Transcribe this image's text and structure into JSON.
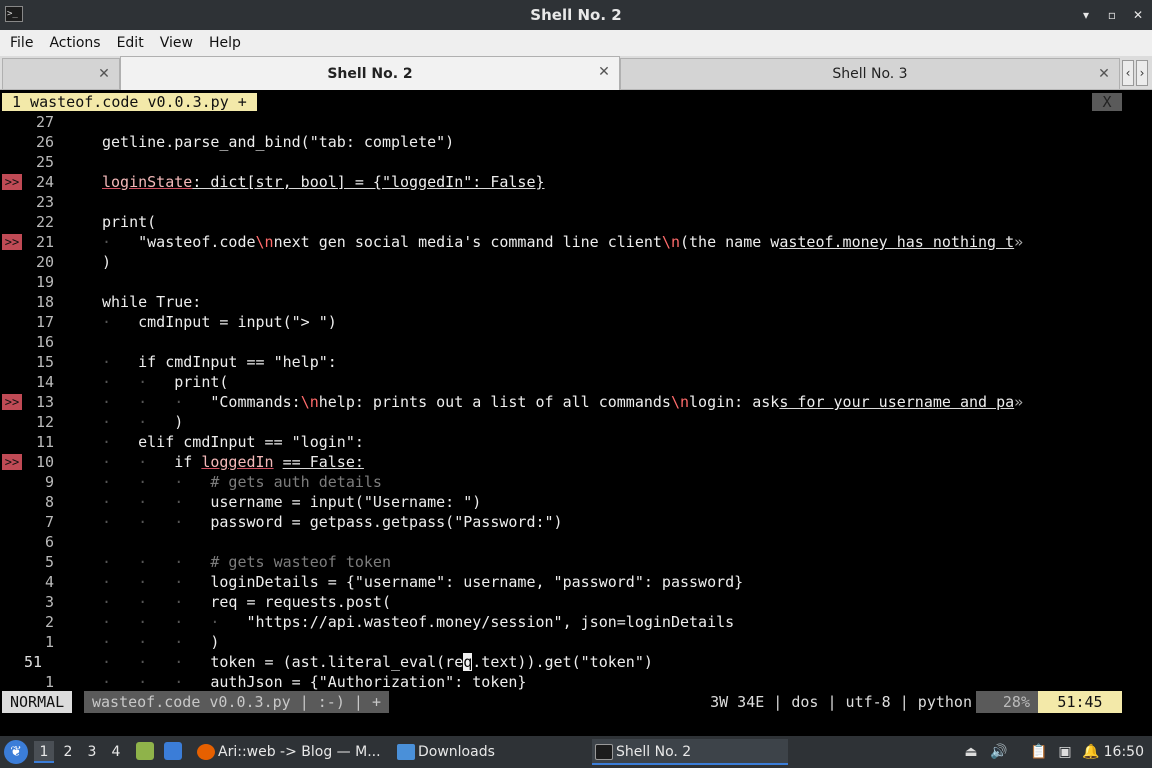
{
  "window": {
    "title": "Shell No. 2",
    "icon": "terminal-icon",
    "controls": [
      "minimize-icon",
      "maximize-icon",
      "close-icon"
    ]
  },
  "menubar": {
    "items": [
      "File",
      "Actions",
      "Edit",
      "View",
      "Help"
    ]
  },
  "tabs": [
    {
      "label": "",
      "active": false
    },
    {
      "label": "Shell No. 2",
      "active": true
    },
    {
      "label": "Shell No. 3",
      "active": false
    }
  ],
  "vim": {
    "buffer_tab": "1 wasteof.code v0.0.3.py +",
    "close_label": "X",
    "lines": [
      {
        "n": "27",
        "sign": "",
        "html": ""
      },
      {
        "n": "26",
        "sign": "",
        "html": "getline.parse_and_bind(\"tab: complete\")"
      },
      {
        "n": "25",
        "sign": "",
        "html": ""
      },
      {
        "n": "24",
        "sign": ">>",
        "html": "<span class=\"ul-red\">loginState</span><span class=\"ul\">: dict[str, bool] = {\"loggedIn\": False}</span>"
      },
      {
        "n": "23",
        "sign": "",
        "html": ""
      },
      {
        "n": "22",
        "sign": "",
        "html": "print("
      },
      {
        "n": "21",
        "sign": ">>",
        "html": "<span class=\"guide\">·</span>   \"wasteof.code<span class=\"esc\">\\n</span>next gen social media's command line client<span class=\"esc\">\\n</span>(the name w<span class=\"ul\">asteof.money has nothing t</span><span class=\"trunc\">»</span>"
      },
      {
        "n": "20",
        "sign": "",
        "html": ")"
      },
      {
        "n": "19",
        "sign": "",
        "html": ""
      },
      {
        "n": "18",
        "sign": "",
        "html": "while True:"
      },
      {
        "n": "17",
        "sign": "",
        "html": "<span class=\"guide\">·</span>   cmdInput = input(\"> \")"
      },
      {
        "n": "16",
        "sign": "",
        "html": ""
      },
      {
        "n": "15",
        "sign": "",
        "html": "<span class=\"guide\">·</span>   if cmdInput == \"help\":"
      },
      {
        "n": "14",
        "sign": "",
        "html": "<span class=\"guide\">·</span>   <span class=\"guide\">·</span>   print("
      },
      {
        "n": "13",
        "sign": ">>",
        "html": "<span class=\"guide\">·</span>   <span class=\"guide\">·</span>   <span class=\"guide\">·</span>   \"Commands:<span class=\"esc\">\\n</span>help: prints out a list of all commands<span class=\"esc\">\\n</span>login: ask<span class=\"ul\">s for your username and pa</span><span class=\"trunc\">»</span>"
      },
      {
        "n": "12",
        "sign": "",
        "html": "<span class=\"guide\">·</span>   <span class=\"guide\">·</span>   )"
      },
      {
        "n": "11",
        "sign": "",
        "html": "<span class=\"guide\">·</span>   elif cmdInput == \"login\":"
      },
      {
        "n": "10",
        "sign": ">>",
        "html": "<span class=\"guide\">·</span>   <span class=\"guide\">·</span>   if <span class=\"ul-red\">loggedIn</span> <span class=\"ul\">== False:</span>"
      },
      {
        "n": "9",
        "sign": "",
        "html": "<span class=\"guide\">·</span>   <span class=\"guide\">·</span>   <span class=\"guide\">·</span>   <span class=\"comment\"># gets auth details</span>"
      },
      {
        "n": "8",
        "sign": "",
        "html": "<span class=\"guide\">·</span>   <span class=\"guide\">·</span>   <span class=\"guide\">·</span>   username = input(\"Username: \")"
      },
      {
        "n": "7",
        "sign": "",
        "html": "<span class=\"guide\">·</span>   <span class=\"guide\">·</span>   <span class=\"guide\">·</span>   password = getpass.getpass(\"Password:\")"
      },
      {
        "n": "6",
        "sign": "",
        "html": ""
      },
      {
        "n": "5",
        "sign": "",
        "html": "<span class=\"guide\">·</span>   <span class=\"guide\">·</span>   <span class=\"guide\">·</span>   <span class=\"comment\"># gets wasteof token</span>"
      },
      {
        "n": "4",
        "sign": "",
        "html": "<span class=\"guide\">·</span>   <span class=\"guide\">·</span>   <span class=\"guide\">·</span>   loginDetails = {\"username\": username, \"password\": password}"
      },
      {
        "n": "3",
        "sign": "",
        "html": "<span class=\"guide\">·</span>   <span class=\"guide\">·</span>   <span class=\"guide\">·</span>   req = requests.post("
      },
      {
        "n": "2",
        "sign": "",
        "html": "<span class=\"guide\">·</span>   <span class=\"guide\">·</span>   <span class=\"guide\">·</span>   <span class=\"guide\">·</span>   \"https://api.wasteof.money/session\", json=loginDetails"
      },
      {
        "n": "1",
        "sign": "",
        "html": "<span class=\"guide\">·</span>   <span class=\"guide\">·</span>   <span class=\"guide\">·</span>   )"
      },
      {
        "n": "51",
        "sign": "",
        "cur": true,
        "html": "<span class=\"guide\">·</span>   <span class=\"guide\">·</span>   <span class=\"guide\">·</span>   token = (ast.literal_eval(re<span class=\"cursor\">q</span>.text)).get(\"token\")"
      },
      {
        "n": "1",
        "sign": "",
        "html": "<span class=\"guide\">·</span>   <span class=\"guide\">·</span>   <span class=\"guide\">·</span>   authJson = {\"Authorization\": token}"
      }
    ],
    "status": {
      "mode": "NORMAL",
      "file": "wasteof.code v0.0.3.py | :-) | +",
      "info": "3W 34E | dos | utf-8 | python",
      "percent": "28%",
      "position": "51:45"
    }
  },
  "taskbar": {
    "desktops": [
      "1",
      "2",
      "3",
      "4"
    ],
    "active_desktop": "1",
    "tasks": [
      {
        "label": "Ari::web -> Blog — M...",
        "icon": "firefox-icon",
        "color": "#e66000"
      },
      {
        "label": "Downloads",
        "icon": "folder-icon",
        "color": "#4a90d9"
      },
      {
        "label": "Shell No. 2",
        "icon": "terminal-icon",
        "color": "#1c1c1c"
      }
    ],
    "clock": "16:50"
  }
}
